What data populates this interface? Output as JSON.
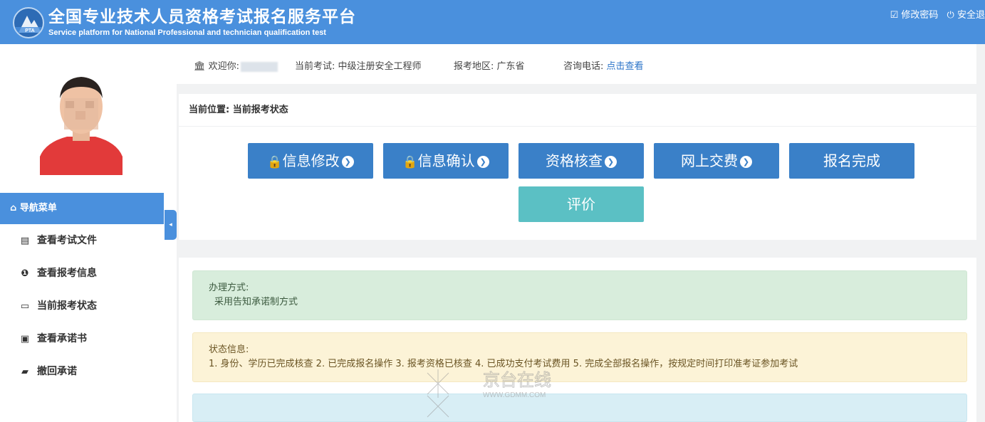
{
  "header": {
    "title": "全国专业技术人员资格考试报名服务平台",
    "subtitle": "Service platform for National Professional and technician qualification test",
    "logo_text": "PTA",
    "change_password": "修改密码",
    "logout": "安全退"
  },
  "sidebar": {
    "nav_title": "导航菜单",
    "items": [
      {
        "label": "查看考试文件",
        "icon": "file-icon"
      },
      {
        "label": "查看报考信息",
        "icon": "info-circle-icon"
      },
      {
        "label": "当前报考状态",
        "icon": "monitor-icon"
      },
      {
        "label": "查看承诺书",
        "icon": "certificate-icon"
      },
      {
        "label": "撤回承诺",
        "icon": "book-icon"
      }
    ]
  },
  "welcome": {
    "greeting": "欢迎你:",
    "exam_label": "当前考试:",
    "exam_value": "中级注册安全工程师",
    "region_label": "报考地区:",
    "region_value": "广东省",
    "phone_label": "咨询电话:",
    "phone_link": "点击查看"
  },
  "panel": {
    "location_label": "当前位置:",
    "location_value": "当前报考状态",
    "steps": [
      {
        "label": "信息修改",
        "locked": true,
        "arrow": true
      },
      {
        "label": "信息确认",
        "locked": true,
        "arrow": true
      },
      {
        "label": "资格核查",
        "locked": false,
        "arrow": true
      },
      {
        "label": "网上交费",
        "locked": false,
        "arrow": true
      },
      {
        "label": "报名完成",
        "locked": false,
        "arrow": false
      }
    ],
    "evaluate": "评价"
  },
  "alerts": {
    "method_title": "办理方式:",
    "method_text": "采用告知承诺制方式",
    "status_title": "状态信息:",
    "status_text": "1. 身份、学历已完成核查 2. 已完成报名操作 3. 报考资格已核查 4. 已成功支付考试费用 5. 完成全部报名操作，按规定时间打印准考证参加考试"
  },
  "watermark": {
    "text": "京台在线",
    "url": "WWW.GDMM.COM"
  },
  "colors": {
    "primary": "#4a90dd",
    "button": "#3a80c8",
    "evaluate": "#5bc0c4",
    "lock": "#ff6a3a"
  }
}
